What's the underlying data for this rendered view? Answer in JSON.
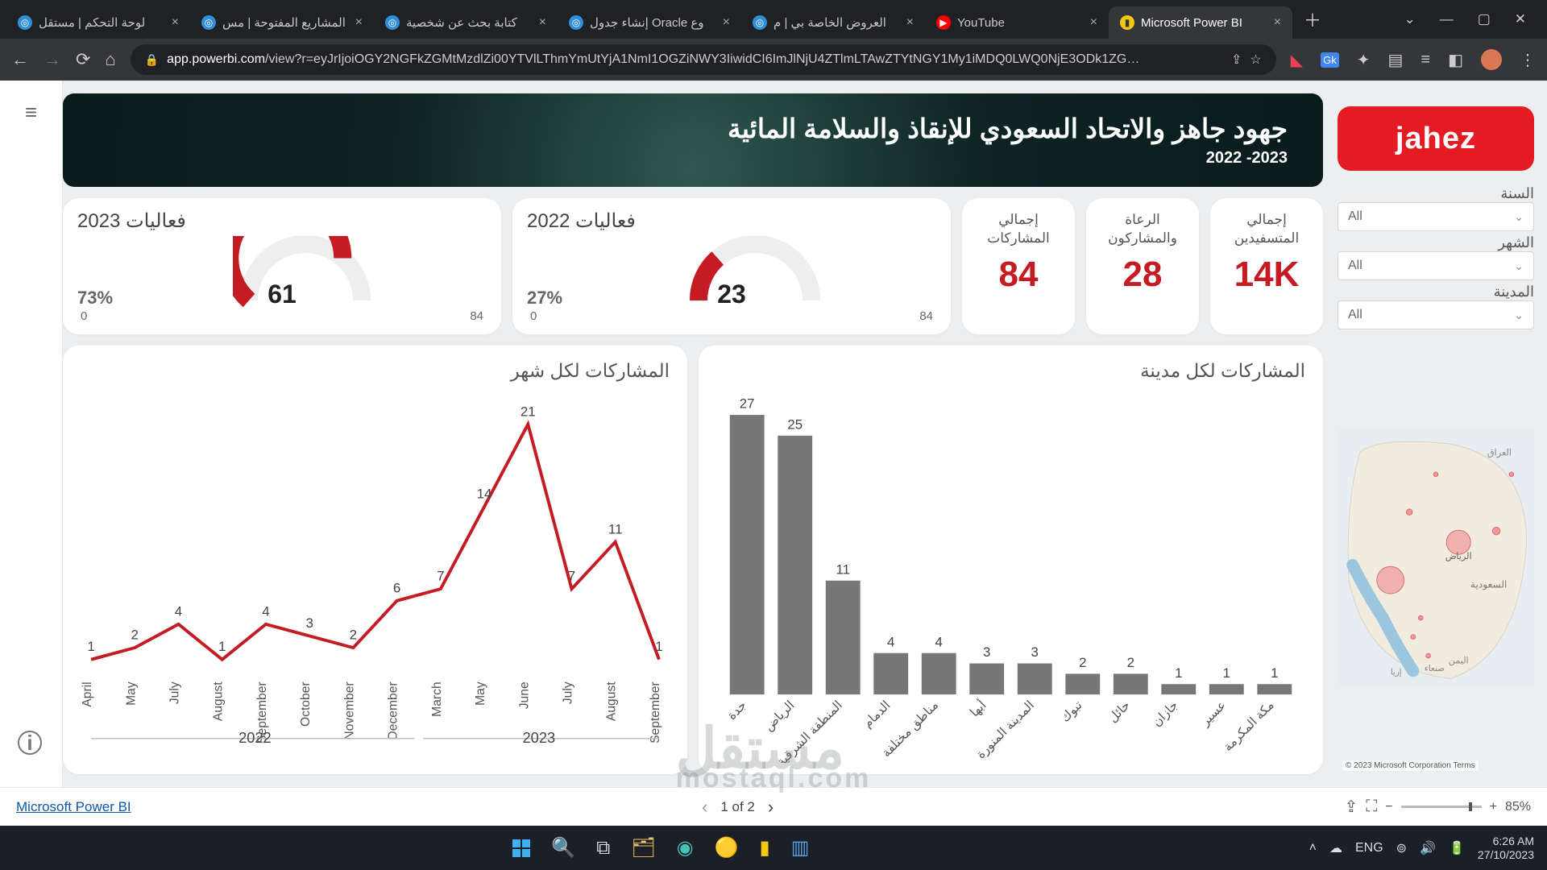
{
  "browser": {
    "tabs": [
      {
        "title": "لوحة التحكم | مستقل",
        "icon": "mostaql"
      },
      {
        "title": "المشاريع المفتوحة | مس",
        "icon": "mostaql"
      },
      {
        "title": "كتابة بحث عن شخصية",
        "icon": "mostaql"
      },
      {
        "title": "إنشاء جدول Oracle وع",
        "icon": "mostaql"
      },
      {
        "title": "العروض الخاصة بي | م",
        "icon": "mostaql"
      },
      {
        "title": "YouTube",
        "icon": "youtube"
      },
      {
        "title": "Microsoft Power BI",
        "icon": "powerbi",
        "active": true
      }
    ],
    "url_prefix": "app.powerbi.com",
    "url_rest": "/view?r=eyJrIjoiOGY2NGFkZGMtMzdlZi00YTVlLThmYmUtYjA1NmI1OGZiNWY3IiwidCI6ImJlNjU4ZTlmLTAwZTYtNGY1My1iMDQ0LWQ0NjE3ODk1ZG…"
  },
  "banner": {
    "title": "جهود جاهز والاتحاد السعودي للإنقاذ والسلامة المائية",
    "subtitle": "2022 -2023"
  },
  "logo": "jahez",
  "gauges": [
    {
      "title": "فعاليات 2023",
      "pct": "73%",
      "value": 61,
      "min": 0,
      "max": 84,
      "fill": 0.73
    },
    {
      "title": "فعاليات 2022",
      "pct": "27%",
      "value": 23,
      "min": 0,
      "max": 84,
      "fill": 0.27
    }
  ],
  "stats": [
    {
      "label": "إجمالي المشاركات",
      "value": "84"
    },
    {
      "label": "الرعاة والمشاركون",
      "value": "28"
    },
    {
      "label": "إجمالي المتسفيدين",
      "value": "14K"
    }
  ],
  "slicers": [
    {
      "label": "السنة",
      "value": "All"
    },
    {
      "label": "الشهر",
      "value": "All"
    },
    {
      "label": "المدينة",
      "value": "All"
    }
  ],
  "chart_data": [
    {
      "type": "line",
      "title": "المشاركات لكل شهر",
      "categories": [
        "April",
        "May",
        "July",
        "August",
        "September",
        "October",
        "November",
        "December",
        "March",
        "May",
        "June",
        "July",
        "August",
        "September"
      ],
      "values": [
        1,
        2,
        4,
        1,
        4,
        3,
        2,
        6,
        7,
        14,
        21,
        7,
        11,
        1
      ],
      "group_labels": [
        "2022",
        "2023"
      ],
      "group_split_index": 8,
      "ylim": [
        0,
        22
      ]
    },
    {
      "type": "bar",
      "title": "المشاركات لكل مدينة",
      "categories": [
        "جدة",
        "الرياض",
        "المنطقة الشرقية",
        "الدمام",
        "مناطق مختلفة",
        "أبها",
        "المدينة المنورة",
        "تبوك",
        "حائل",
        "جازان",
        "عسير",
        "مكة المكرمة"
      ],
      "values": [
        27,
        25,
        11,
        4,
        4,
        3,
        3,
        2,
        2,
        1,
        1,
        1
      ],
      "ylim": [
        0,
        28
      ]
    }
  ],
  "map": {
    "labels": [
      "العراق",
      "الرياض",
      "السعودية",
      "اليمن",
      "صنعاء",
      "إريا"
    ],
    "attrib": "© 2023 Microsoft Corporation Terms"
  },
  "footer": {
    "link": "Microsoft Power BI",
    "pager": "1 of 2",
    "zoom": "85%"
  },
  "taskbar": {
    "lang": "ENG",
    "time": "6:26 AM",
    "date": "27/10/2023"
  },
  "watermark": {
    "ar": "مستقل",
    "lat": "mostaql.com"
  }
}
